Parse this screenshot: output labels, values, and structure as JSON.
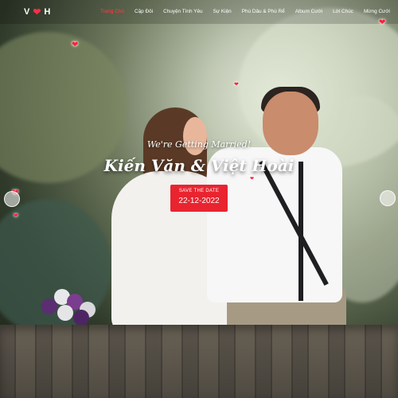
{
  "brand": {
    "left_letter": "V",
    "right_letter": "H"
  },
  "nav": {
    "items": [
      {
        "label": "Trang Chủ",
        "active": true
      },
      {
        "label": "Cặp Đôi",
        "active": false
      },
      {
        "label": "Chuyện Tình Yêu",
        "active": false
      },
      {
        "label": "Sự Kiện",
        "active": false
      },
      {
        "label": "Phù Dâu & Phù Rể",
        "active": false
      },
      {
        "label": "Album Cưới",
        "active": false
      },
      {
        "label": "Lời Chúc",
        "active": false
      },
      {
        "label": "Mừng Cưới",
        "active": false
      }
    ]
  },
  "hero": {
    "subtitle": "We're Getting Married!",
    "couple_names": "Kiến Văn & Việt Hoài",
    "save_the_date_label": "SAVE THE DATE",
    "date": "22-12-2022"
  },
  "colors": {
    "accent": "#e9242f",
    "nav_active": "#ff3c46",
    "heart": "#ff1f38"
  },
  "icons": [
    "heart-icon"
  ]
}
